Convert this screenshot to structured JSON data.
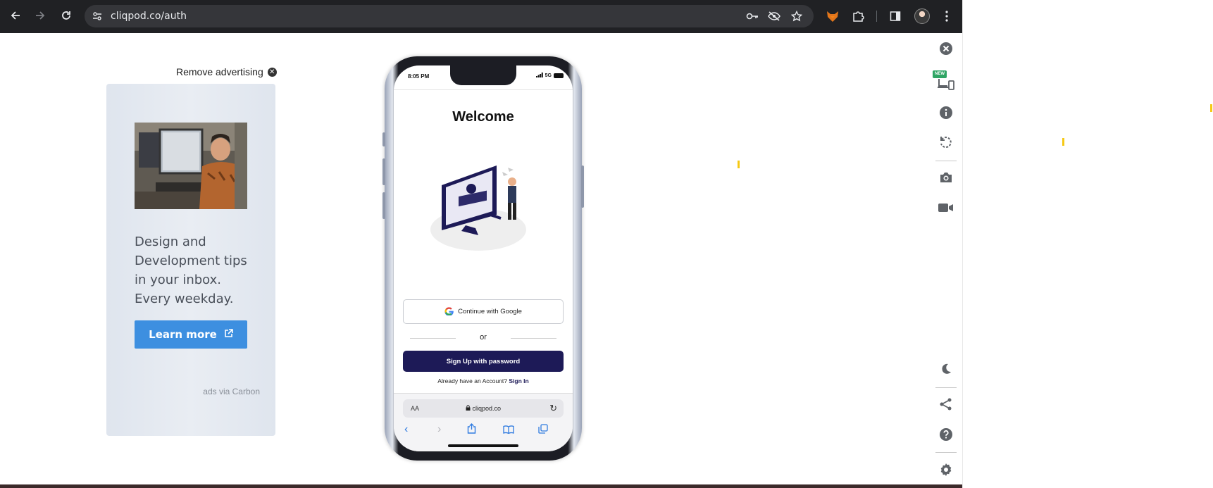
{
  "browser": {
    "url": "cliqpod.co/auth",
    "icons": [
      "back-icon",
      "forward-icon",
      "reload-icon",
      "site-info-icon",
      "key-icon",
      "eye-off-icon",
      "star-icon",
      "fox-extension-icon",
      "puzzle-icon",
      "side-panel-icon",
      "profile-avatar",
      "more-menu-icon"
    ]
  },
  "ad": {
    "remove_label": "Remove advertising",
    "text": "Design and Development tips in your inbox. Every weekday.",
    "button_label": "Learn more",
    "attribution": "ads via Carbon",
    "button_color": "#3d8fe0"
  },
  "phone": {
    "status": {
      "time": "8:05 PM",
      "network": "5G"
    },
    "welcome": "Welcome",
    "google_button": "Continue with Google",
    "divider_text": "or",
    "signup_button": "Sign Up with password",
    "already_text": "Already have an Account?",
    "signin_link": "Sign In",
    "safari": {
      "aa": "AA",
      "domain": "cliqpod.co"
    },
    "accent_color": "#1d1a57"
  },
  "toolbar": {
    "new_badge": "NEW",
    "icons": [
      "close-icon",
      "devices-icon",
      "info-icon",
      "rotate-icon",
      "camera-icon",
      "video-icon",
      "moon-icon",
      "share-icon",
      "help-icon",
      "settings-icon"
    ]
  }
}
